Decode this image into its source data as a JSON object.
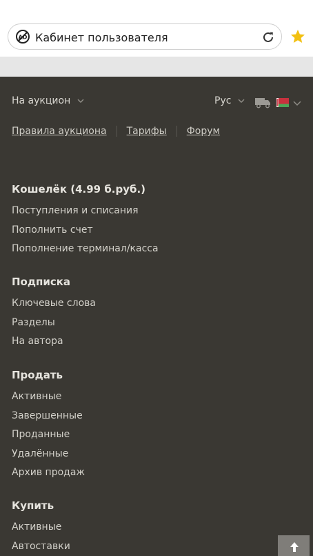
{
  "browser": {
    "address_text": "Кабинет пользователя",
    "site_icon": "ad-block-icon",
    "reload_icon": "reload-icon",
    "bookmark_icon": "star-icon",
    "star_color": "#f2c011"
  },
  "topnav": {
    "auction_menu_label": "На аукцион",
    "language_label": "Рус",
    "delivery_icon": "truck-icon",
    "country_flag": "belarus-flag-icon"
  },
  "links": [
    "Правила аукциона",
    "Тарифы",
    "Форум"
  ],
  "sections": [
    {
      "title": "Кошелёк (4.99 б.руб.)",
      "items": [
        "Поступления и списания",
        "Пополнить счет",
        "Пополнение терминал/касса"
      ]
    },
    {
      "title": "Подписка",
      "items": [
        "Ключевые слова",
        "Разделы",
        "На автора"
      ]
    },
    {
      "title": "Продать",
      "items": [
        "Активные",
        "Завершенные",
        "Проданные",
        "Удалённые",
        "Архив продаж"
      ]
    },
    {
      "title": "Купить",
      "items": [
        "Активные",
        "Автоставки"
      ]
    }
  ],
  "scroll_top_icon": "arrow-up-icon",
  "colors": {
    "background": "#3a3833",
    "text": "#d3d1ca",
    "accent_star": "#f2c011"
  }
}
